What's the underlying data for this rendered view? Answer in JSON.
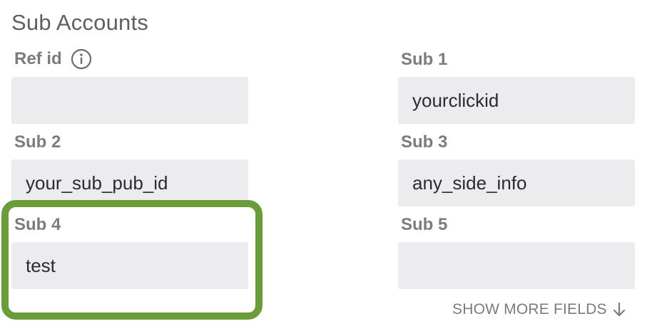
{
  "section": {
    "title": "Sub Accounts"
  },
  "fields": {
    "ref_id": {
      "label": "Ref id",
      "value": ""
    },
    "sub1": {
      "label": "Sub 1",
      "value": "yourclickid"
    },
    "sub2": {
      "label": "Sub 2",
      "value": "your_sub_pub_id"
    },
    "sub3": {
      "label": "Sub 3",
      "value": "any_side_info"
    },
    "sub4": {
      "label": "Sub 4",
      "value": "test"
    },
    "sub5": {
      "label": "Sub 5",
      "value": ""
    }
  },
  "show_more": {
    "label": "SHOW MORE FIELDS"
  },
  "icons": {
    "info": "info-icon",
    "arrow": "arrow-down-icon"
  },
  "colors": {
    "highlight": "#6a9c3a",
    "input_bg": "#ececef",
    "label": "#7b7b80"
  }
}
